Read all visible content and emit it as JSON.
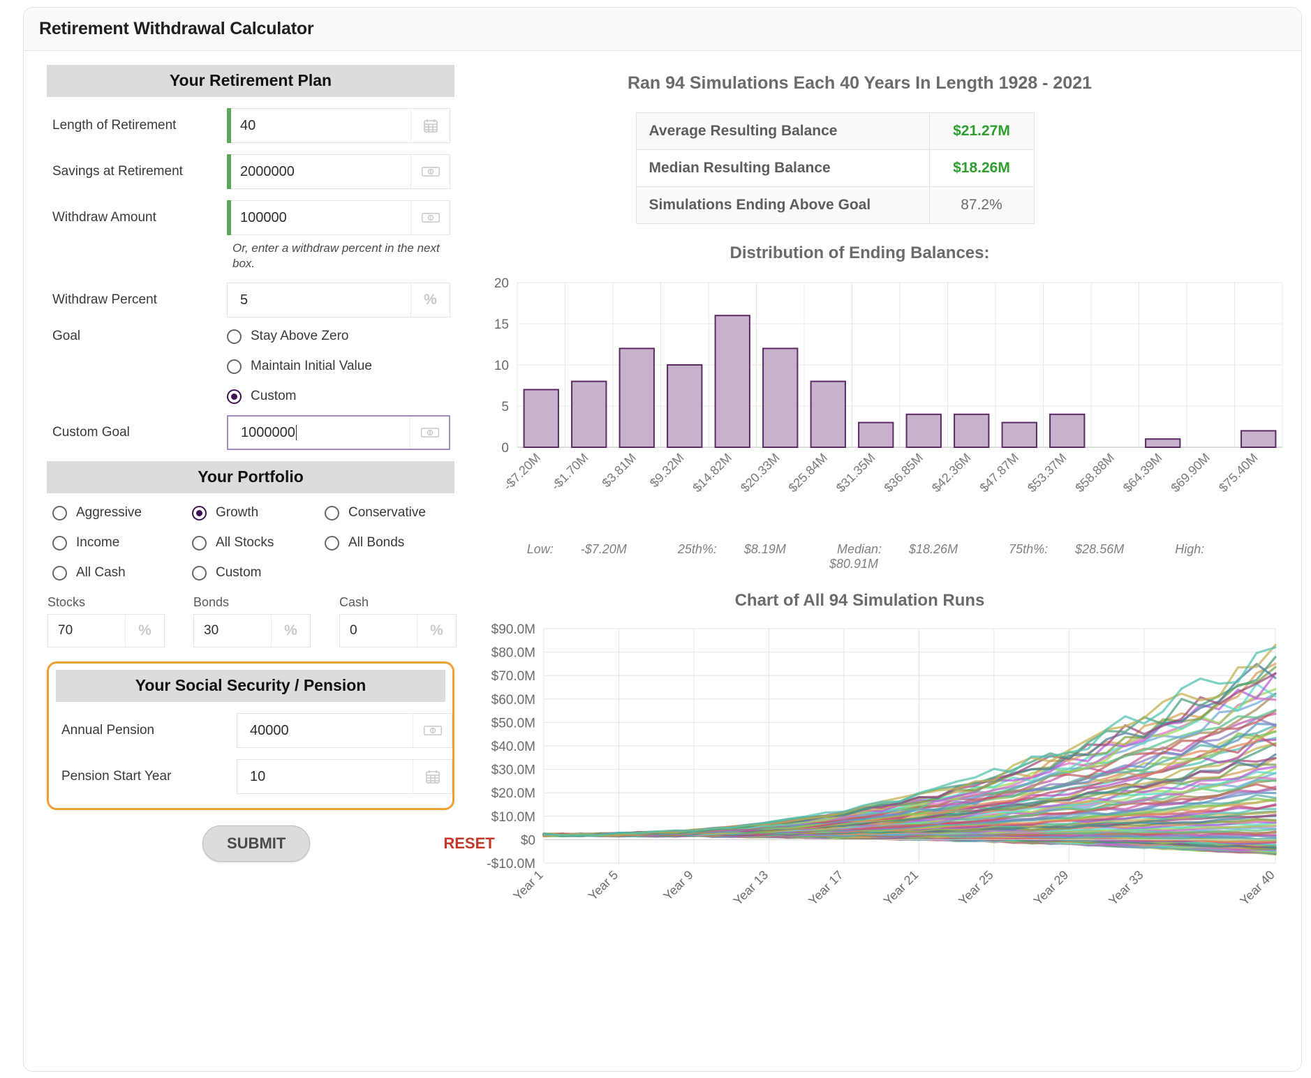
{
  "window": {
    "title": "Retirement Withdrawal Calculator"
  },
  "plan": {
    "banner": "Your Retirement Plan",
    "length_label": "Length of Retirement",
    "length_value": "40",
    "savings_label": "Savings at Retirement",
    "savings_value": "2000000",
    "withdraw_label": "Withdraw Amount",
    "withdraw_value": "100000",
    "withdraw_hint": "Or, enter a withdraw percent in the next box.",
    "percent_label": "Withdraw Percent",
    "percent_value": "5",
    "percent_suffix": "%",
    "goal_label": "Goal",
    "goal_options": [
      {
        "label": "Stay Above Zero",
        "selected": false
      },
      {
        "label": "Maintain Initial Value",
        "selected": false
      },
      {
        "label": "Custom",
        "selected": true
      }
    ],
    "custom_goal_label": "Custom Goal",
    "custom_goal_value": "1000000"
  },
  "portfolio": {
    "banner": "Your Portfolio",
    "options": [
      {
        "label": "Aggressive",
        "selected": false
      },
      {
        "label": "Growth",
        "selected": true
      },
      {
        "label": "Conservative",
        "selected": false
      },
      {
        "label": "Income",
        "selected": false
      },
      {
        "label": "All Stocks",
        "selected": false
      },
      {
        "label": "All Bonds",
        "selected": false
      },
      {
        "label": "All Cash",
        "selected": false
      },
      {
        "label": "Custom",
        "selected": false
      }
    ],
    "allocations": [
      {
        "caption": "Stocks",
        "value": "70",
        "suffix": "%"
      },
      {
        "caption": "Bonds",
        "value": "30",
        "suffix": "%"
      },
      {
        "caption": "Cash",
        "value": "0",
        "suffix": "%"
      }
    ]
  },
  "pension": {
    "banner": "Your Social Security / Pension",
    "annual_label": "Annual Pension",
    "annual_value": "40000",
    "start_label": "Pension Start Year",
    "start_value": "10",
    "highlight_color": "#f0a030"
  },
  "actions": {
    "submit_label": "SUBMIT",
    "reset_label": "RESET",
    "reset_color": "#c0392b"
  },
  "results": {
    "heading": "Ran 94 Simulations Each 40 Years In Length 1928 - 2021",
    "rows": [
      {
        "label": "Average Resulting Balance",
        "value": "$21.27M",
        "highlight": true
      },
      {
        "label": "Median Resulting Balance",
        "value": "$18.26M",
        "highlight": true
      },
      {
        "label": "Simulations Ending Above Goal",
        "value": "87.2%",
        "highlight": false
      }
    ],
    "accent_green": "#2e9e2e"
  },
  "chart_data": [
    {
      "type": "bar",
      "title": "Distribution of Ending Balances:",
      "categories": [
        "-$7.20M",
        "-$1.70M",
        "$3.81M",
        "$9.32M",
        "$14.82M",
        "$20.33M",
        "$25.84M",
        "$31.35M",
        "$36.85M",
        "$42.36M",
        "$47.87M",
        "$53.37M",
        "$58.88M",
        "$64.39M",
        "$69.90M",
        "$75.40M"
      ],
      "values": [
        7,
        8,
        12,
        10,
        16,
        12,
        8,
        3,
        4,
        4,
        3,
        4,
        0,
        1,
        0,
        2
      ],
      "xlabel": "",
      "ylabel": "",
      "ylim": [
        0,
        20
      ],
      "yticks": [
        0,
        5,
        10,
        15,
        20
      ],
      "grid": true,
      "bar_fill": "#c7b2cd",
      "bar_stroke": "#5b2a63",
      "stats": [
        {
          "name": "Low:",
          "value": "-$7.20M"
        },
        {
          "name": "25th%:",
          "value": "$8.19M"
        },
        {
          "name": "Median:",
          "value": "$18.26M"
        },
        {
          "name": "75th%:",
          "value": "$28.56M"
        },
        {
          "name": "High:",
          "value": "$80.91M"
        }
      ]
    },
    {
      "type": "line",
      "title": "Chart of All 94 Simulation Runs",
      "xlabel": "",
      "ylabel": "",
      "xticks": [
        "Year 1",
        "Year 5",
        "Year 9",
        "Year 13",
        "Year 17",
        "Year 21",
        "Year 25",
        "Year 29",
        "Year 33",
        "Year 40"
      ],
      "yticks": [
        "-$10.0M",
        "$0",
        "$10.0M",
        "$20.0M",
        "$30.0M",
        "$40.0M",
        "$50.0M",
        "$60.0M",
        "$70.0M",
        "$80.0M",
        "$90.0M"
      ],
      "ylim": [
        -10,
        90
      ],
      "xlim": [
        1,
        40
      ],
      "n_series": 94,
      "grid": true,
      "note": "94 overlapping colored balance trajectories fanning out from ~$2M at Year 1 to between -$5M and $81M at Year 40"
    }
  ]
}
